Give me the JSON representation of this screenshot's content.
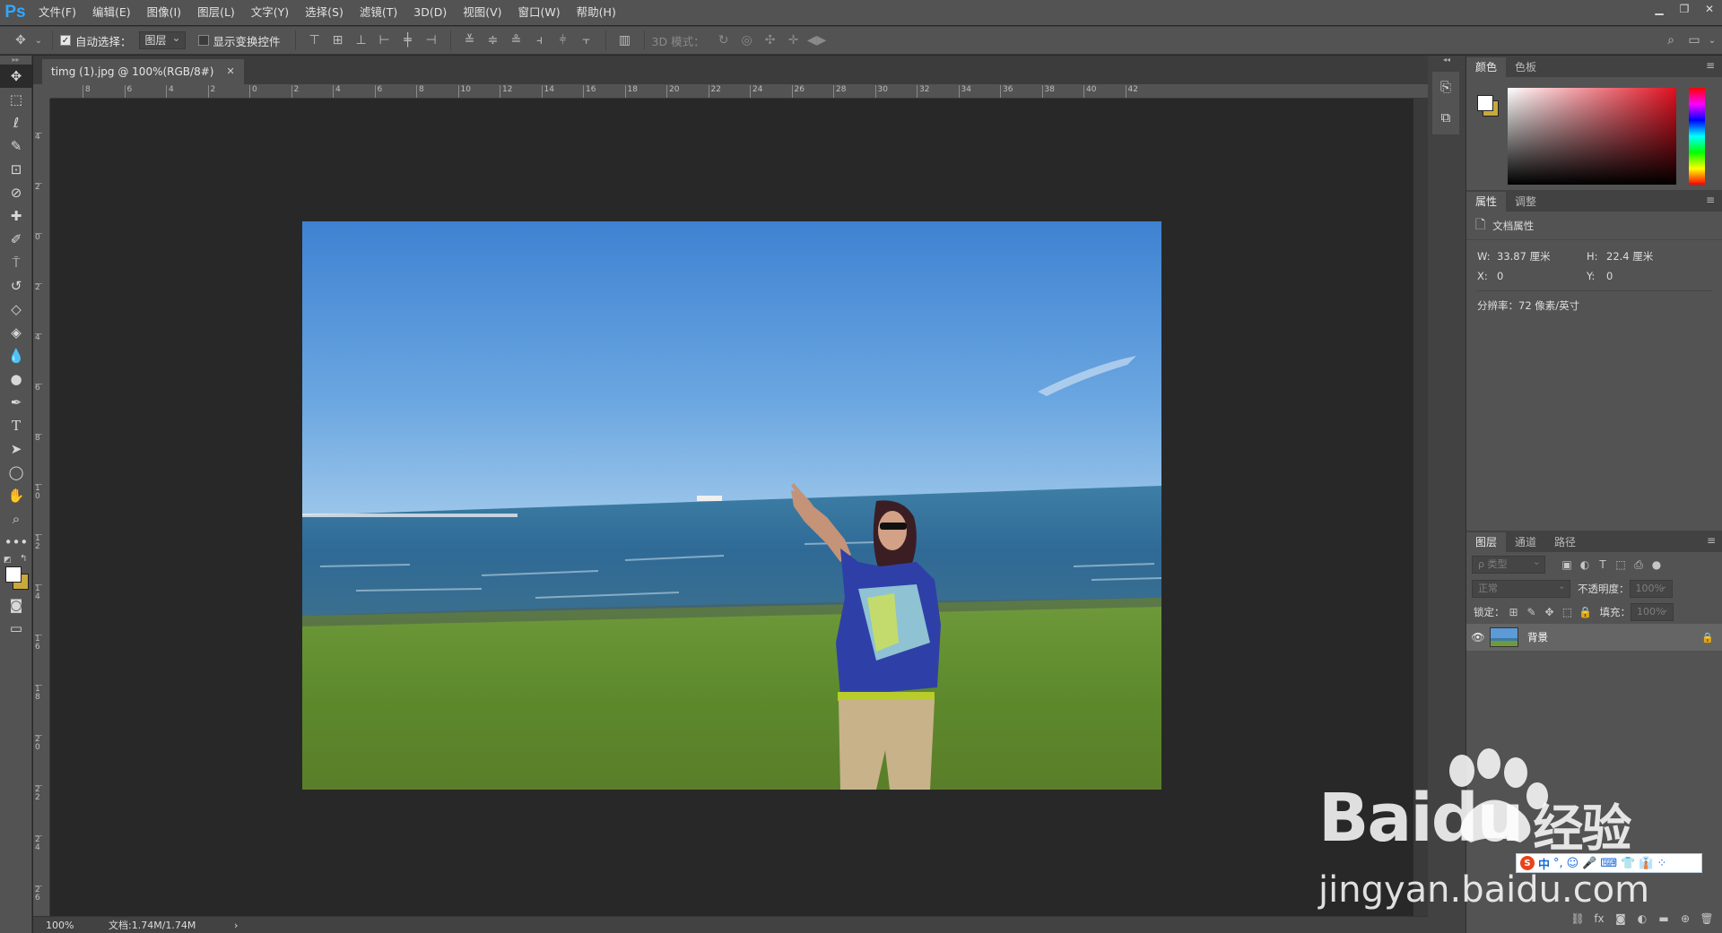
{
  "app": {
    "logo": "Ps",
    "menus": [
      "文件(F)",
      "编辑(E)",
      "图像(I)",
      "图层(L)",
      "文字(Y)",
      "选择(S)",
      "滤镜(T)",
      "3D(D)",
      "视图(V)",
      "窗口(W)",
      "帮助(H)"
    ],
    "window_controls": [
      "minimize-icon",
      "restore-icon",
      "close-icon"
    ]
  },
  "options": {
    "auto_select_label": "自动选择：",
    "auto_select_checked": true,
    "auto_select_value": "图层",
    "show_transform_label": "显示变换控件",
    "show_transform_checked": false,
    "mode_3d_label": "3D 模式："
  },
  "document": {
    "tab_title": "timg (1).jpg @ 100%(RGB/8#)",
    "ruler_top_labels": [
      "8",
      "6",
      "4",
      "2",
      "0",
      "2",
      "4",
      "6",
      "8",
      "10",
      "12",
      "14",
      "16",
      "18",
      "20",
      "22",
      "24",
      "26",
      "28",
      "30",
      "32",
      "34",
      "36",
      "38",
      "40",
      "42"
    ],
    "ruler_left_labels": [
      "4",
      "2",
      "0",
      "2",
      "4",
      "6",
      "8",
      "1 0",
      "1 2",
      "1 4",
      "1 6",
      "1 8",
      "2 0",
      "2 2",
      "2 4",
      "2 6"
    ]
  },
  "status": {
    "zoom": "100%",
    "doc_size": "文档:1.74M/1.74M",
    "arrow": "›"
  },
  "color_panel": {
    "tabs": [
      "颜色",
      "色板"
    ],
    "foreground": "#ffffff",
    "background": "#c8a93a",
    "hue_color": "#e01020"
  },
  "properties_panel": {
    "tabs": [
      "属性",
      "调整"
    ],
    "section": "文档属性",
    "w_label": "W:",
    "w_value": "33.87 厘米",
    "h_label": "H:",
    "h_value": "22.4 厘米",
    "x_label": "X:",
    "x_value": "0",
    "y_label": "Y:",
    "y_value": "0",
    "resolution": "分辨率：72 像素/英寸"
  },
  "layers_panel": {
    "tabs": [
      "图层",
      "通道",
      "路径"
    ],
    "filter_placeholder": "ρ 类型",
    "blend_mode": "正常",
    "opacity_label": "不透明度：",
    "opacity_value": "100%",
    "lock_label": "锁定：",
    "fill_label": "填充：",
    "fill_value": "100%",
    "layers": [
      {
        "name": "背景",
        "visible": true,
        "locked": true
      }
    ],
    "bottom_icons": [
      "link-icon",
      "fx-icon",
      "mask-icon",
      "adjustment-icon",
      "group-icon",
      "new-layer-icon",
      "trash-icon"
    ]
  },
  "watermark": {
    "brand": "Baidu",
    "brand_cn": "经验",
    "url": "jingyan.baidu.com"
  },
  "ime": {
    "items": [
      "中",
      "°,",
      "☺",
      "🎤",
      "⌨",
      "👕",
      "👔",
      "⁘"
    ]
  }
}
